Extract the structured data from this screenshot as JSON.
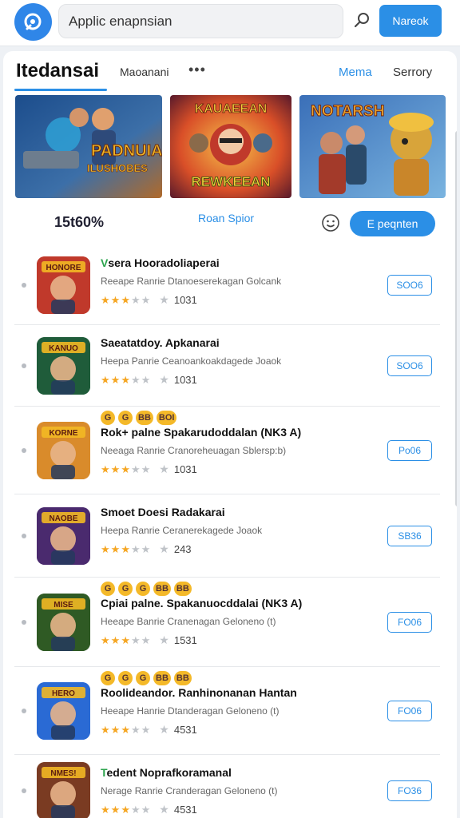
{
  "header": {
    "search_value": "Applic enapnsian",
    "search_button": "Nareok"
  },
  "tabs": {
    "main": "Itedansai",
    "second": "Maoanani",
    "more": "•••",
    "right_1": "Mema",
    "right_2": "Serrory"
  },
  "banners": [
    {
      "title": "PADNUIA",
      "subtitle": "ILUSHOBES",
      "accent": "#f2b824"
    },
    {
      "title": "KAUAEEAN",
      "subtitle": "REWKEEAN",
      "accent": "#e8742a"
    },
    {
      "title": "NOTARSH",
      "subtitle": "",
      "accent": "#f0a82a"
    }
  ],
  "stats": {
    "count": "15t60%",
    "link": "Roan Spior",
    "button": "E peqnten"
  },
  "apps": [
    {
      "title_mark": "V",
      "title": "sera Hooradoliaperai",
      "desc": "Reeape Ranrie Dtanoeserekagan Golcank",
      "stars": 3,
      "rating": "1031",
      "button": "SOO6",
      "badges": [],
      "icon_bg": "#c0392b",
      "icon_label": "HONORE"
    },
    {
      "title_mark": "",
      "title": "Saeatatdoy. Apkanarai",
      "desc": "Heepa Panrie Ceanoankoakdagede Joaok",
      "stars": 3,
      "rating": "1031",
      "button": "SOO6",
      "badges": [],
      "icon_bg": "#1f5c3a",
      "icon_label": "KANUO"
    },
    {
      "title_mark": "",
      "title": "Rok+ palne Spakarudoddalan (NK3 A)",
      "desc": "Neeaga Ranrie Cranoreheuagan Sblersp:b)",
      "stars": 3,
      "rating": "1031",
      "button": "Po06",
      "badges": [
        "G",
        "G",
        "BB",
        "BOI"
      ],
      "icon_bg": "#d98b2b",
      "icon_label": "KORNE"
    },
    {
      "title_mark": "",
      "title": "Smoet Doesi Radakarai",
      "desc": "Heepa Ranrie Ceranerekagede Joaok",
      "stars": 3,
      "rating": "243",
      "button": "SB36",
      "badges": [],
      "icon_bg": "#4a2a6e",
      "icon_label": "NAOBE"
    },
    {
      "title_mark": "",
      "title": "Cpiai palne. Spakanuocddalai (NK3 A)",
      "desc": "Heeape Banrie Cranenagan Geloneno (t)",
      "stars": 3,
      "rating": "1531",
      "button": "FO06",
      "badges": [
        "G",
        "G",
        "G",
        "BB",
        "BB"
      ],
      "icon_bg": "#2f5a24",
      "icon_label": "MISE"
    },
    {
      "title_mark": "",
      "title": "Roolideandor. Ranhinonanan Hantan",
      "desc": "Heeape Hanrie Dtanderagan Geloneno (t)",
      "stars": 3,
      "rating": "4531",
      "button": "FO06",
      "badges": [
        "G",
        "G",
        "G",
        "BB",
        "BB"
      ],
      "icon_bg": "#2a6ad4",
      "icon_label": "HERO"
    },
    {
      "title_mark": "T",
      "title": "edent Noprafkoramanal",
      "desc": "Nerage Ranrie Cranderagan Geloneno (t)",
      "stars": 3,
      "rating": "4531",
      "button": "FO36",
      "badges": [],
      "icon_bg": "#7a3b22",
      "icon_label": "NMES!"
    }
  ],
  "colors": {
    "accent": "#2b8fe6",
    "star": "#f5a623",
    "badge": "#f4b929"
  }
}
